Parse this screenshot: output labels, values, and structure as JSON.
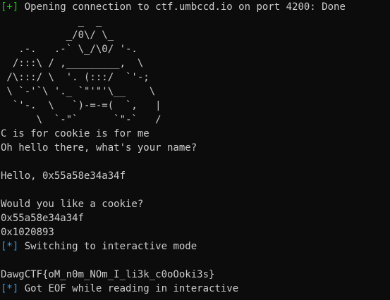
{
  "terminal": {
    "line_connect_tag": "[+]",
    "line_connect_text": " Opening connection to ctf.umbccd.io on port 4200: Done",
    "ascii_art": "             _  _\n           _/0\\/ \\_\n   .-.   .-` \\_/\\0/ '-.\n  /:::\\ / ,_________,  \\\n /\\:::/ \\  '. (:::/  `'-;\n \\ `-'`\\ '._ `\"'\"'\\__    \\\n  `'-.  \\   `)-=-=(  `,   |\n      \\  `-\"`      `\"-`   /",
    "line_cookie": "C is for cookie is for me",
    "line_name_prompt": "Oh hello there, what's your name?",
    "line_blank_1": "",
    "line_hello": "Hello, 0x55a58e34a34f",
    "line_blank_2": "",
    "line_cookie_prompt": "Would you like a cookie?",
    "line_addr_1": "0x55a58e34a34f",
    "line_addr_2": "0x1020893",
    "line_interactive_tag": "[*]",
    "line_interactive_text": " Switching to interactive mode",
    "line_blank_3": "",
    "line_flag": "DawgCTF{oM_n0m_NOm_I_li3k_c0oOoki3s}",
    "line_eof_tag": "[*]",
    "line_eof_text": " Got EOF while reading in interactive"
  },
  "colors": {
    "background": "#0c0c0c",
    "foreground": "#cccccc",
    "info_tag": "#3a96dd",
    "success_tag": "#16c60c"
  }
}
